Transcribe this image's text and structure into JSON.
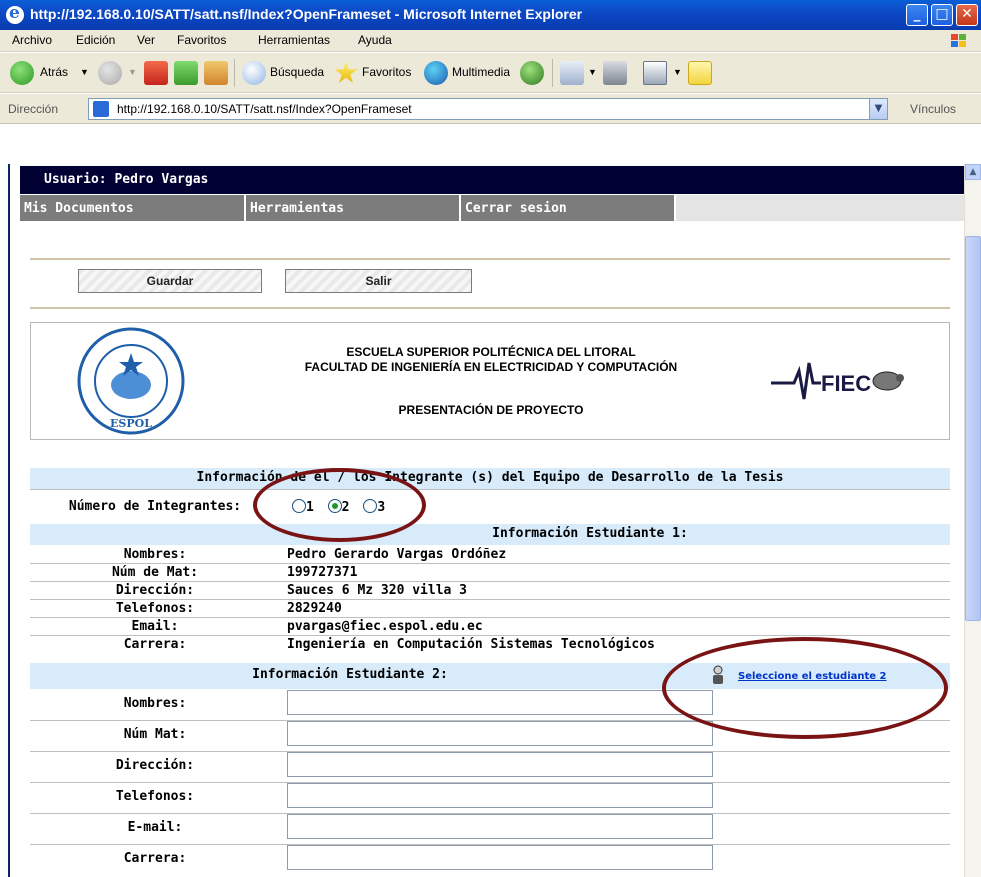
{
  "window": {
    "title": "http://192.168.0.10/SATT/satt.nsf/Index?OpenFrameset - Microsoft Internet Explorer"
  },
  "menubar": {
    "items": [
      "Archivo",
      "Edición",
      "Ver",
      "Favoritos",
      "Herramientas",
      "Ayuda"
    ]
  },
  "toolbar": {
    "back": "Atrás",
    "search": "Búsqueda",
    "favorites": "Favoritos",
    "media": "Multimedia"
  },
  "addressbar": {
    "label": "Dirección",
    "url": "http://192.168.0.10/SATT/satt.nsf/Index?OpenFrameset",
    "links": "Vínculos"
  },
  "page": {
    "user_label": "Usuario: Pedro Vargas",
    "nav": [
      "Mis Documentos",
      "Herramientas",
      "Cerrar sesion"
    ],
    "buttons": {
      "save": "Guardar",
      "exit": "Salir"
    },
    "institution": {
      "line1": "ESCUELA SUPERIOR POLITÉCNICA DEL LITORAL",
      "line2": "FACULTAD DE INGENIERÍA EN ELECTRICIDAD Y COMPUTACIÓN",
      "line3": "PRESENTACIÓN DE PROYECTO",
      "logo_left": "ESPOL",
      "logo_right": "FIEC"
    },
    "form": {
      "section_title": "Información de el / los Integrante (s) del Equipo de Desarrollo de la Tesis",
      "members_label": "Número de Integrantes:",
      "member_options": [
        "1",
        "2",
        "3"
      ],
      "member_selected": "2",
      "student1_title": "Información Estudiante 1:",
      "student1": [
        {
          "label": "Nombres:",
          "value": "Pedro Gerardo Vargas Ordóñez"
        },
        {
          "label": "Núm de Mat:",
          "value": "199727371"
        },
        {
          "label": "Dirección:",
          "value": "Sauces 6 Mz 320 villa 3"
        },
        {
          "label": "Telefonos:",
          "value": "2829240"
        },
        {
          "label": "Email:",
          "value": "pvargas@fiec.espol.edu.ec"
        },
        {
          "label": "Carrera:",
          "value": "Ingeniería en Computación Sistemas Tecnológicos"
        }
      ],
      "student2_title": "Información Estudiante 2:",
      "select_student2": "Seleccione el estudiante 2",
      "student2_labels": [
        "Nombres:",
        "Núm Mat:",
        "Dirección:",
        "Telefonos:",
        "E-mail:",
        "Carrera:"
      ],
      "student2_values": [
        "",
        "",
        "",
        "",
        "",
        ""
      ]
    }
  }
}
